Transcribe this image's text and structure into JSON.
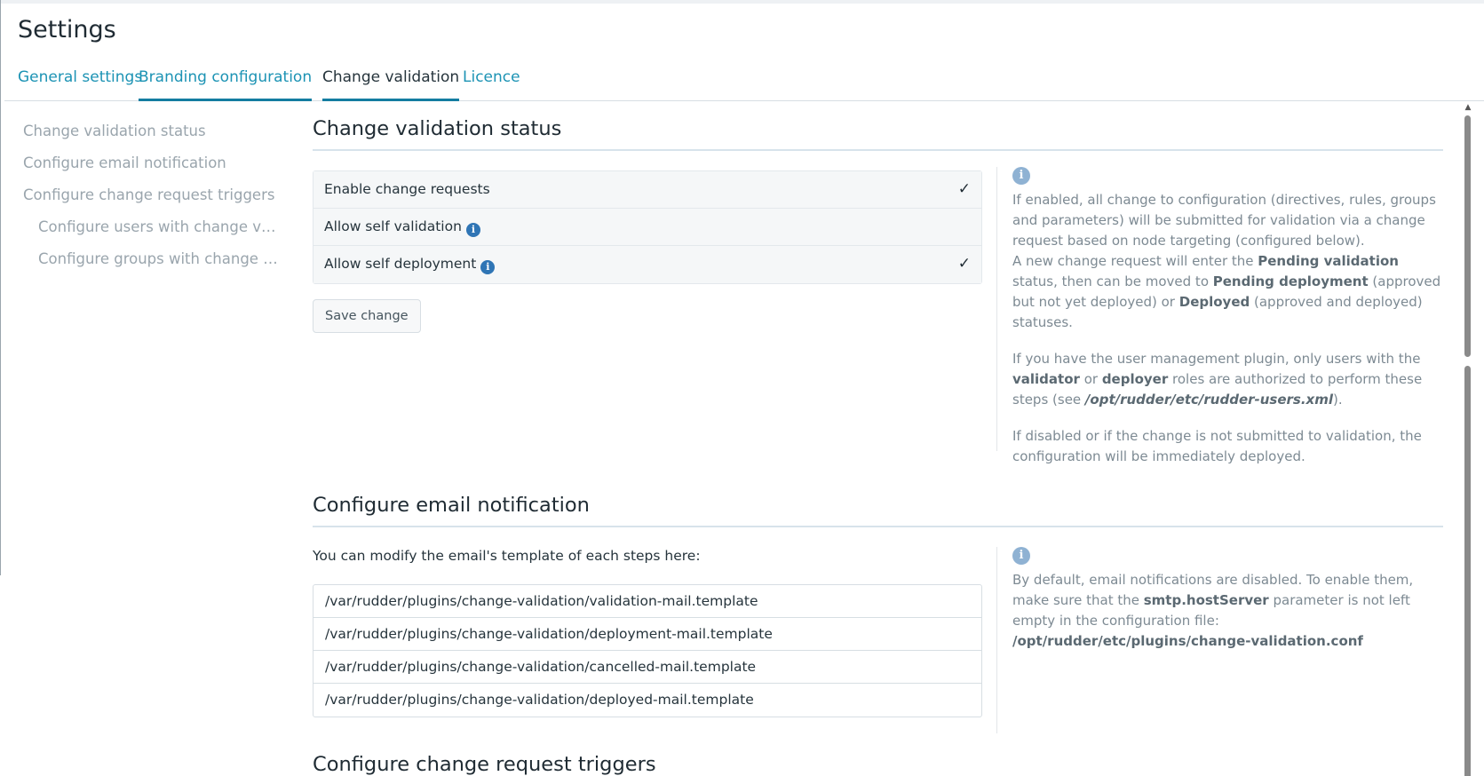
{
  "page": {
    "title": "Settings"
  },
  "tabs": [
    {
      "label": "General settings"
    },
    {
      "label": "Branding configuration"
    },
    {
      "label": "Change validation"
    },
    {
      "label": "Licence"
    }
  ],
  "sidenav": {
    "items": [
      {
        "label": "Change validation status"
      },
      {
        "label": "Configure email notification"
      },
      {
        "label": "Configure change request triggers"
      },
      {
        "label": "Configure users with change validation"
      },
      {
        "label": "Configure groups with change validation"
      }
    ]
  },
  "validation_status": {
    "title": "Change validation status",
    "options": [
      {
        "label": "Enable change requests",
        "checked": true,
        "info": false
      },
      {
        "label": "Allow self validation",
        "checked": false,
        "info": true
      },
      {
        "label": "Allow self deployment",
        "checked": true,
        "info": true
      }
    ],
    "check_glyph": "✓",
    "info_glyph": "i",
    "save_label": "Save change",
    "help": {
      "p1_a": "If enabled, all change to configuration (directives, rules, groups and parameters) will be submitted for validation via a change request based on node targeting (configured below).",
      "p1_b": "A new change request will enter the ",
      "p1_pending_validation": "Pending validation",
      "p1_c": " status, then can be moved to ",
      "p1_pending_deployment": "Pending deployment",
      "p1_d": " (approved but not yet deployed) or ",
      "p1_deployed": "Deployed",
      "p1_e": " (approved and deployed) statuses.",
      "p2_a": "If you have the user management plugin, only users with the ",
      "p2_validator": "validator",
      "p2_b": " or ",
      "p2_deployer": "deployer",
      "p2_c": " roles are authorized to perform these steps (see ",
      "p2_path": "/opt/rudder/etc/rudder-users.xml",
      "p2_d": ").",
      "p3": "If disabled or if the change is not submitted to validation, the configuration will be immediately deployed."
    }
  },
  "email_notification": {
    "title": "Configure email notification",
    "intro": "You can modify the email's template of each steps here:",
    "templates": [
      "/var/rudder/plugins/change-validation/validation-mail.template",
      "/var/rudder/plugins/change-validation/deployment-mail.template",
      "/var/rudder/plugins/change-validation/cancelled-mail.template",
      "/var/rudder/plugins/change-validation/deployed-mail.template"
    ],
    "help": {
      "a": "By default, email notifications are disabled. To enable them, make sure that the ",
      "param": "smtp.hostServer",
      "b": " parameter is not left empty in the configuration file: ",
      "path": "/opt/rudder/etc/plugins/change-validation.conf"
    }
  },
  "triggers": {
    "title": "Configure change request triggers"
  },
  "scrollbar": {
    "up_glyph": "▲"
  }
}
